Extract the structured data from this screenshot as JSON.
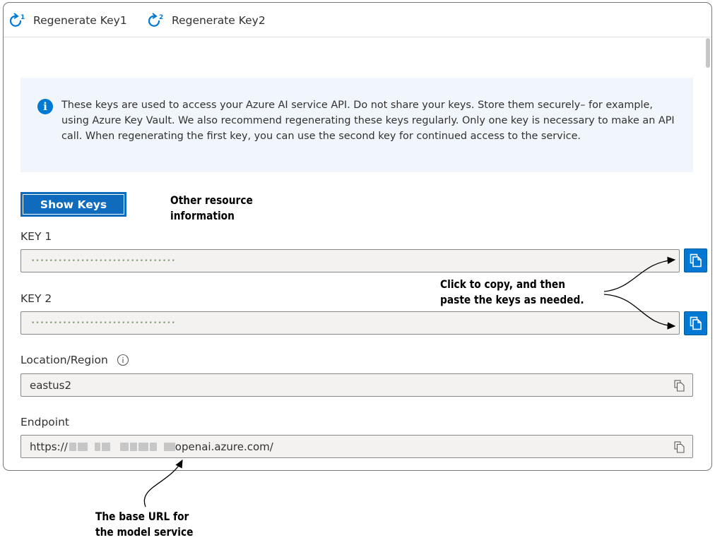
{
  "toolbar": {
    "regen1_label": "Regenerate Key1",
    "regen2_label": "Regenerate Key2"
  },
  "info": {
    "text": "These keys are used to access your Azure AI service API. Do not share your keys. Store them securely– for example, using Azure Key Vault. We also recommend regenerating these keys regularly. Only one key is necessary to make an API call. When regenerating the first key, you can use the second key for continued access to the service."
  },
  "show_keys_label": "Show Keys",
  "key1": {
    "label": "KEY 1",
    "value": "••••••••••••••••••••••••••••••••"
  },
  "key2": {
    "label": "KEY 2",
    "value": "••••••••••••••••••••••••••••••••"
  },
  "location": {
    "label": "Location/Region",
    "value": "eastus2"
  },
  "endpoint": {
    "label": "Endpoint",
    "value_prefix": "https://",
    "value_suffix": "openai.azure.com/"
  },
  "annotations": {
    "other_resource_line1": "Other resource",
    "other_resource_line2": "information",
    "copy_line1": "Click to copy, and then",
    "copy_line2": "paste the keys as needed.",
    "base_url_line1": "The base URL for",
    "base_url_line2": "the model service"
  },
  "colors": {
    "accent": "#0078d4",
    "info_bg": "#f0f6fc",
    "field_bg": "#f3f2f1"
  },
  "icons": [
    "regenerate-key1-icon",
    "regenerate-key2-icon",
    "info-icon",
    "copy-icon",
    "tooltip-info-icon"
  ]
}
